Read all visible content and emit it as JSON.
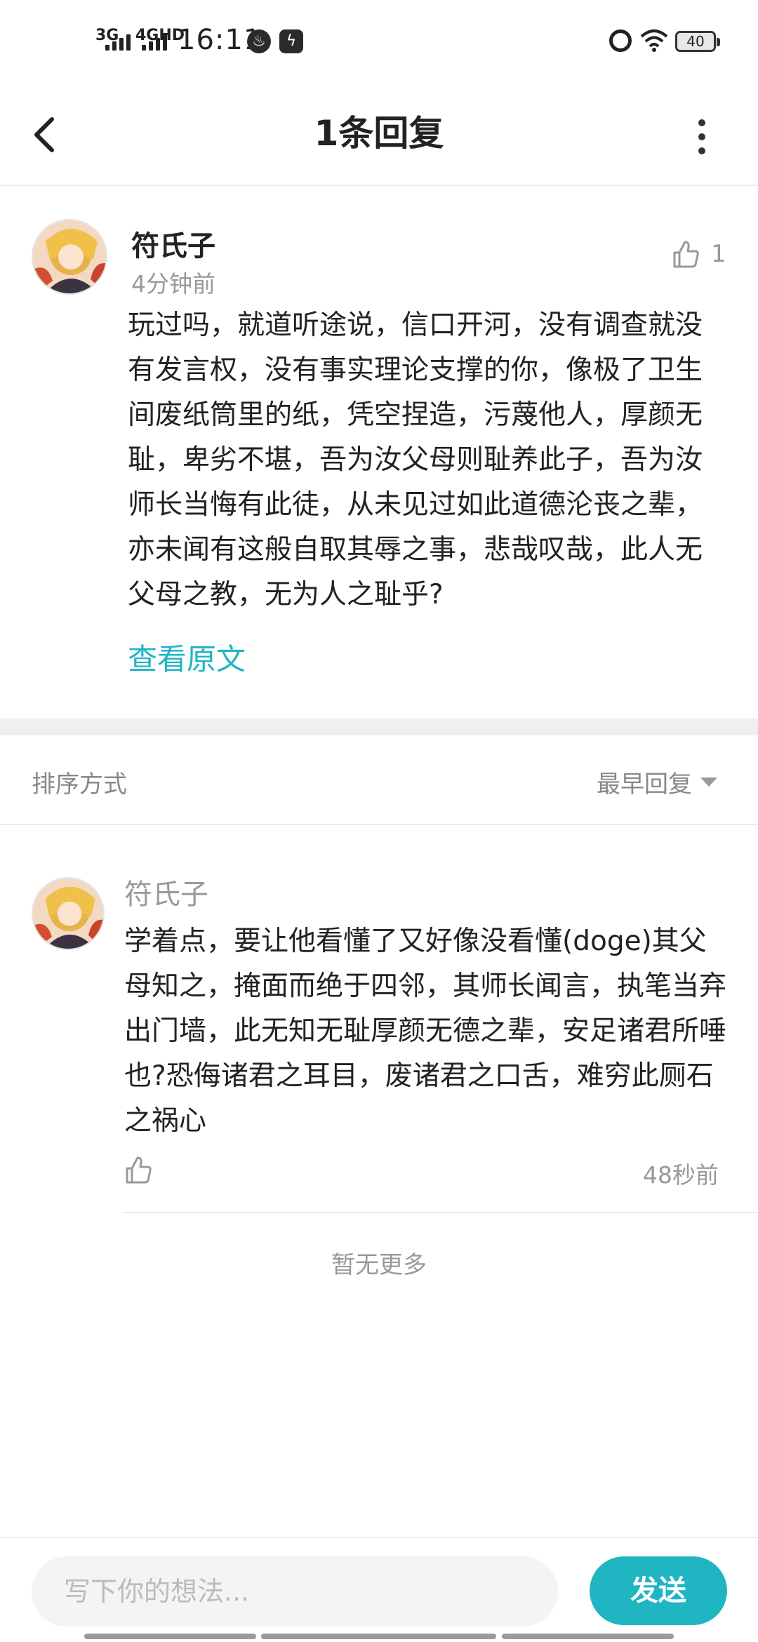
{
  "status_bar": {
    "network_1": "3G",
    "network_2": "4GHD",
    "time": "16:11",
    "battery": "40"
  },
  "header": {
    "title": "1条回复"
  },
  "main_comment": {
    "author": "符氏子",
    "time": "4分钟前",
    "like_count": "1",
    "text": "玩过吗，就道听途说，信口开河，没有调查就没有发言权，没有事实理论支撑的你，像极了卫生间废纸筒里的纸，凭空捏造，污蔑他人，厚颜无耻，卑劣不堪，吾为汝父母则耻养此子，吾为汝师长当悔有此徒，从未见过如此道德沦丧之辈，亦未闻有这般自取其辱之事，悲哉叹哉，此人无父母之教，无为人之耻乎?",
    "view_original": "查看原文"
  },
  "sort": {
    "label": "排序方式",
    "value": "最早回复"
  },
  "replies": [
    {
      "author": "符氏子",
      "text": "学着点，要让他看懂了又好像没看懂(doge)其父母知之，掩面而绝于四邻，其师长闻言，执笔当弃出门墙，此无知无耻厚颜无德之辈，安足诸君所唾也?恐侮诸君之耳目，废诸君之口舌，难穷此厕石之祸心",
      "time": "48秒前"
    }
  ],
  "no_more": "暂无更多",
  "composer": {
    "placeholder": "写下你的想法...",
    "send_label": "发送"
  },
  "colors": {
    "accent": "#1fb5c3",
    "muted_text": "#999999",
    "primary_text": "#222222",
    "divider": "#efefef"
  },
  "icons": [
    "signal-icon",
    "fire-app-icon",
    "bolt-app-icon",
    "alarm-icon",
    "wifi-icon",
    "battery-icon",
    "back-icon",
    "more-icon",
    "thumbs-up-icon",
    "dropdown-triangle-icon"
  ]
}
